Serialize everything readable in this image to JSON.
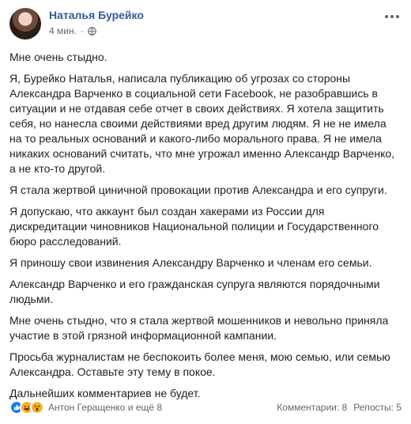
{
  "header": {
    "author": "Наталья Бурейко",
    "time": "4 мин.",
    "separator": "·"
  },
  "post": {
    "paragraphs": [
      "Мне очень стыдно.",
      "Я, Бурейко Наталья, написала публикацию об угрозах со стороны Александра Варченко в социальной сети Facebook, не разобравшись в ситуации и не отдавая себе отчет в своих действиях. Я хотела защитить себя, но нанесла своими действиями вред другим людям. Я не не имела на то реальных оснований и какого-либо морального права. Я не имела никаких оснований считать, что мне угрожал именно Александр Варченко, а не кто-то другой.",
      "Я стала жертвой циничной провокации против Александра и его супруги.",
      "Я допускаю, что аккаунт был создан хакерами из России для дискредитации чиновников Национальной полиции и Государственного бюро расследований.",
      "Я приношу свои извинения Александру Варченко и членам его семьи.",
      "Александр Варченко и его гражданская супруга являются порядочными людьми.",
      "Мне очень стыдно, что я стала жертвой мошенников и невольно приняла участие в этой грязной информационной кампании.",
      "Просьба журналистам не беспокоить более меня, мою семью, или семью Александра. Оставьте эту тему в покое.",
      "Дальнейших комментариев не будет."
    ]
  },
  "footer": {
    "reactors": "Антон Геращенко и ещё 8",
    "comments": "Комментарии: 8",
    "shares": "Репосты: 5",
    "reaction_icons": [
      "like-icon",
      "haha-icon",
      "wow-icon"
    ]
  },
  "colors": {
    "author": "#385898",
    "secondary_text": "#606770",
    "like": "#1877f2",
    "emoji": "#f7b125"
  }
}
